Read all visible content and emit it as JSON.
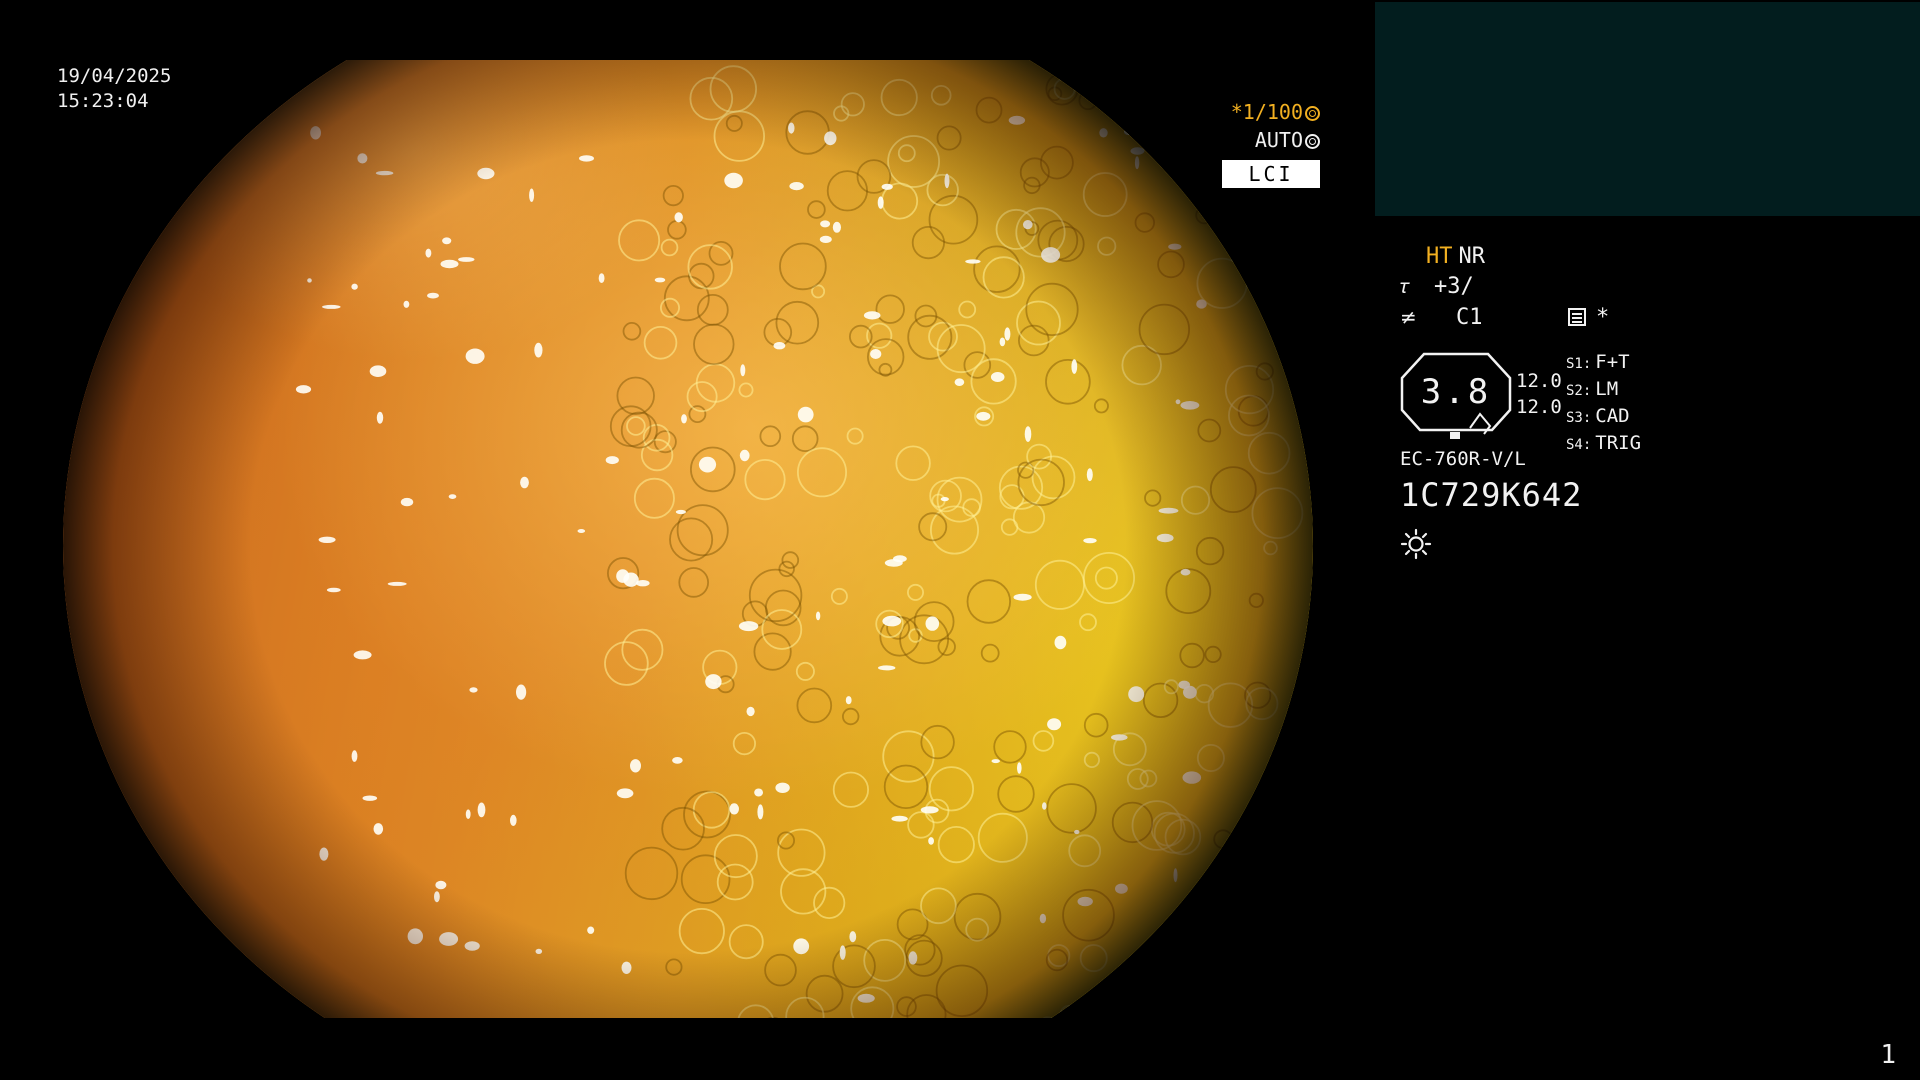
{
  "datetime": {
    "date": "19/04/2025",
    "time": "15:23:04"
  },
  "indicators": {
    "shutter": "*1/100",
    "shutter_icon": "shutter-icon",
    "iris": "AUTO",
    "iris_icon": "iris-icon",
    "mode": "LCI"
  },
  "panel": {
    "ht": "HT",
    "nr": "NR",
    "enhancement_icon": "enhancement-icon",
    "enhancement": "+3/",
    "color_icon": "color-icon",
    "color": "C1",
    "memory_icon": "memory-icon",
    "memory": "*",
    "zoom": "3.8",
    "zoom_values": [
      "12.0",
      "12.0"
    ],
    "switches": [
      {
        "key": "S1:",
        "value": "F+T"
      },
      {
        "key": "S2:",
        "value": "LM"
      },
      {
        "key": "S3:",
        "value": "CAD"
      },
      {
        "key": "S4:",
        "value": "TRIG"
      }
    ],
    "scope_model": "EC-760R-V/L",
    "scope_serial": "1C729K642",
    "light_icon": "light-icon"
  },
  "page_number": "1",
  "colors": {
    "accent_amber": "#f2b021",
    "background": "#000000",
    "thumbnail_bg": "#021d1e"
  }
}
